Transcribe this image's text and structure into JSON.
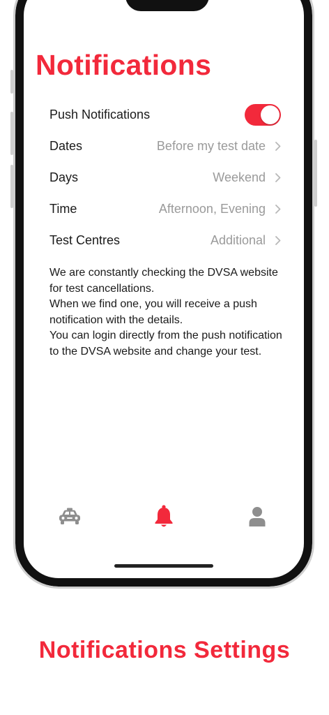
{
  "screen": {
    "title": "Notifications",
    "settings": [
      {
        "label": "Push Notifications",
        "type": "toggle",
        "on": true
      },
      {
        "label": "Dates",
        "value": "Before my test date"
      },
      {
        "label": "Days",
        "value": "Weekend"
      },
      {
        "label": "Time",
        "value": "Afternoon, Evening"
      },
      {
        "label": "Test Centres",
        "value": "Additional"
      }
    ],
    "description": [
      "We are constantly checking the DVSA website for test cancellations.",
      "When we find one, you will receive a push notification with the details.",
      "You can login directly from the push notification to the DVSA website and change your test."
    ],
    "tabbar": {
      "tabs": [
        {
          "icon": "car-icon",
          "active": false
        },
        {
          "icon": "bell-icon",
          "active": true
        },
        {
          "icon": "person-icon",
          "active": false
        }
      ]
    }
  },
  "caption": "Notifications Settings",
  "colors": {
    "accent": "#f2293b",
    "inactive_icon": "#8e8e8e",
    "secondary_text": "#9a9a9a"
  }
}
